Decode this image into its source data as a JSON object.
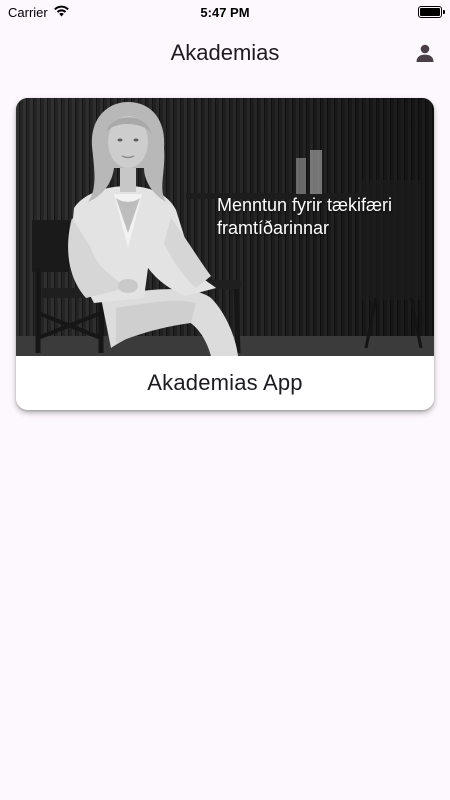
{
  "status_bar": {
    "carrier": "Carrier",
    "time": "5:47 PM",
    "battery_level": 1.0
  },
  "app_bar": {
    "title": "Akademias",
    "account_icon": "person-icon"
  },
  "cards": [
    {
      "image_caption": "Menntun fyrir tækifæri framtíðarinnar",
      "title": "Akademias App"
    }
  ],
  "colors": {
    "background": "#fdf8fd",
    "card": "#ffffff",
    "text": "#1d1b20",
    "account_icon": "#4a3f45"
  }
}
